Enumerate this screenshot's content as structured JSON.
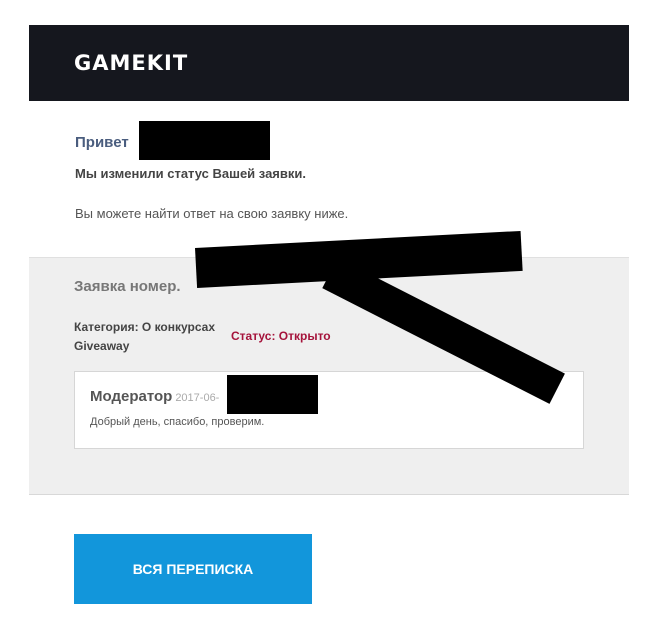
{
  "header": {
    "logo_text": "GAMEKIT"
  },
  "greeting": {
    "text": "Привет"
  },
  "status_changed": {
    "text": "Мы изменили статус Вашей заявки."
  },
  "find_answer": {
    "text": "Вы можете найти ответ на свою заявку ниже."
  },
  "ticket": {
    "title": "Заявка номер.",
    "category": "Категория: О конкурсах Giveaway",
    "status": "Статус: Открыто",
    "status_color": "#a5133b"
  },
  "reply": {
    "author": "Модератор",
    "date": "2017-06-",
    "text": "Добрый день, спасибо, проверим."
  },
  "button": {
    "label": "ВСЯ ПЕРЕПИСКА",
    "color": "#1296db"
  },
  "colors": {
    "header_bg": "#15171e",
    "section_bg": "#efefef"
  }
}
